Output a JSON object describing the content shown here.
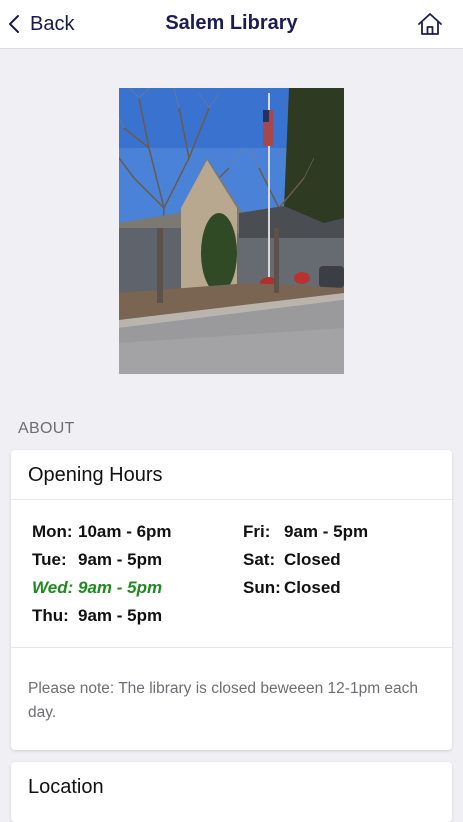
{
  "nav": {
    "back_label": "Back",
    "title": "Salem Library"
  },
  "about": {
    "section_label": "ABOUT"
  },
  "hours": {
    "card_title": "Opening Hours",
    "rows_left": [
      {
        "day": "Mon:",
        "time": "10am - 6pm",
        "today": false
      },
      {
        "day": "Tue:",
        "time": "9am - 5pm",
        "today": false
      },
      {
        "day": "Wed:",
        "time": "9am - 5pm",
        "today": true
      },
      {
        "day": "Thu:",
        "time": "9am - 5pm",
        "today": false
      }
    ],
    "rows_right": [
      {
        "day": "Fri:",
        "time": "9am - 5pm",
        "today": false
      },
      {
        "day": "Sat:",
        "time": "Closed",
        "today": false
      },
      {
        "day": "Sun:",
        "time": "Closed",
        "today": false
      }
    ],
    "note": "Please note: The library is closed beweeen 12-1pm each day."
  },
  "location": {
    "card_title": "Location"
  },
  "colors": {
    "today": "#1f8a1f",
    "nav_title": "#1c1c55"
  }
}
